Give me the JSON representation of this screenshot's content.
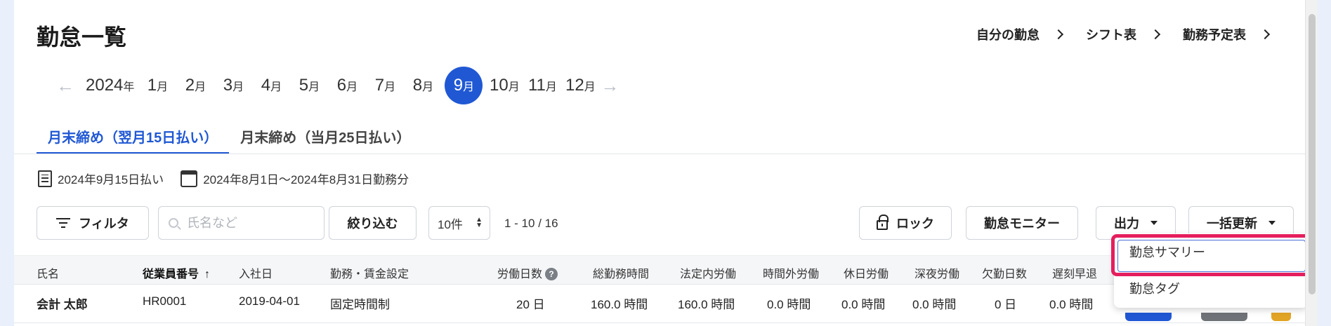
{
  "page": {
    "title": "勤怠一覧",
    "links": [
      "自分の勤怠",
      "シフト表",
      "勤務予定表"
    ]
  },
  "months": {
    "year": "2024",
    "year_suffix": "年",
    "month_suffix": "月",
    "items": [
      "1",
      "2",
      "3",
      "4",
      "5",
      "6",
      "7",
      "8",
      "9",
      "10",
      "11",
      "12"
    ],
    "active": "9",
    "prev_icon": "arrow-left-icon",
    "next_icon": "arrow-right-icon"
  },
  "tabs": [
    {
      "label": "月末締め（翌月15日払い）",
      "active": true
    },
    {
      "label": "月末締め（当月25日払い）",
      "active": false
    }
  ],
  "info": {
    "pay_date": "2024年9月15日払い",
    "period": "2024年8月1日〜2024年8月31日勤務分"
  },
  "toolbar": {
    "filter_label": "フィルタ",
    "search_placeholder": "氏名など",
    "narrow_label": "絞り込む",
    "per_page": "10件",
    "pager": "1 - 10 / 16",
    "lock_label": "ロック",
    "monitor_label": "勤怠モニター",
    "export_label": "出力",
    "bulk_label": "一括更新"
  },
  "table": {
    "headers": [
      "氏名",
      "従業員番号",
      "入社日",
      "勤務・賃金設定",
      "労働日数",
      "総勤務時間",
      "法定内労働",
      "時間外労働",
      "休日労働",
      "深夜労働",
      "欠勤日数",
      "遅刻早退"
    ],
    "sort_icon": "↑",
    "help_icon": "?",
    "rows": [
      [
        "会計 太郎",
        "HR0001",
        "2019-04-01",
        "固定時間制",
        "20 日",
        "160.0 時間",
        "160.0 時間",
        "0.0 時間",
        "0.0 時間",
        "0.0 時間",
        "0 日",
        "0.0 時間"
      ]
    ]
  },
  "dropdown": {
    "items": [
      "勤怠サマリー",
      "勤怠タグ"
    ]
  },
  "colors": {
    "accent": "#2058d4",
    "highlight": "#e51e5d",
    "background": "#e9effb"
  }
}
